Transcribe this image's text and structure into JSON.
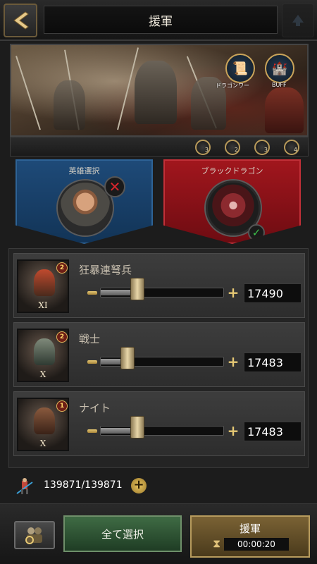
{
  "header": {
    "title": "援軍",
    "back_icon": "chevron-left-icon",
    "right_icon": "scroll-up-icon"
  },
  "banner": {
    "dragon_power_label": "ドラゴンワー",
    "buff_label": "BUFF",
    "slots": [
      "3",
      "2",
      "3",
      "4"
    ]
  },
  "hero_panel": {
    "title": "英雄選択",
    "color": "#1e4a78"
  },
  "dragon_panel": {
    "title": "ブラックドラゴン",
    "color": "#a1161d"
  },
  "troops": [
    {
      "name": "狂暴連弩兵",
      "tier": "XI",
      "level": "2",
      "count": "17490",
      "fill": 0.3
    },
    {
      "name": "戦士",
      "tier": "X",
      "level": "2",
      "count": "17483",
      "fill": 0.22
    },
    {
      "name": "ナイト",
      "tier": "X",
      "level": "1",
      "count": "17483",
      "fill": 0.3
    }
  ],
  "footer": {
    "total": "139871/139871",
    "select_all_label": "全て選択",
    "send_label": "援軍",
    "timer": "00:00:20"
  },
  "colors": {
    "gold": "#e6c874",
    "accent_green": "#3f6b44",
    "accent_gold": "#7a6234"
  }
}
